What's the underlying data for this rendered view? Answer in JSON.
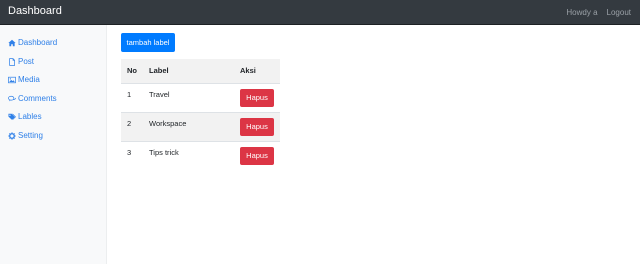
{
  "navbar": {
    "brand": "Dashboard",
    "greeting": "Howdy a",
    "logout": "Logout"
  },
  "sidebar": {
    "items": [
      {
        "label": "Dashboard",
        "icon": "home-icon"
      },
      {
        "label": "Post",
        "icon": "file-icon"
      },
      {
        "label": "Media",
        "icon": "image-icon"
      },
      {
        "label": "Comments",
        "icon": "comments-icon"
      },
      {
        "label": "Lables",
        "icon": "tags-icon"
      },
      {
        "label": "Setting",
        "icon": "gear-icon"
      }
    ]
  },
  "main": {
    "add_button": "tambah label",
    "table": {
      "headers": {
        "no": "No",
        "label": "Label",
        "action": "Aksi"
      },
      "rows": [
        {
          "no": "1",
          "label": "Travel",
          "action": "Hapus"
        },
        {
          "no": "2",
          "label": "Workspace",
          "action": "Hapus"
        },
        {
          "no": "3",
          "label": "Tips trick",
          "action": "Hapus"
        }
      ]
    }
  },
  "colors": {
    "navbar_bg": "#343a40",
    "sidebar_bg": "#f8f9fa",
    "link": "#2f80e8",
    "primary": "#007bff",
    "danger": "#dc3545"
  }
}
